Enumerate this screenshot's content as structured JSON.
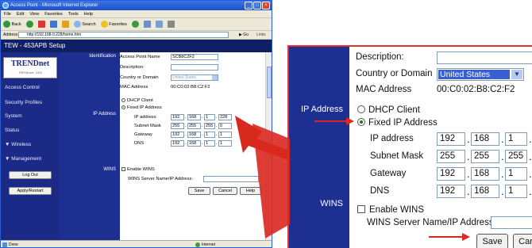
{
  "browser": {
    "title": "Access Point - Microsoft Internet Explorer",
    "menu": [
      "File",
      "Edit",
      "View",
      "Favorites",
      "Tools",
      "Help"
    ],
    "toolbar": {
      "back": "Back",
      "search": "Search",
      "favorites": "Favorites"
    },
    "address_label": "Address",
    "address": "http://192.168.0.228/home.htm",
    "go": "Go",
    "links": "Links",
    "status_left": "Done",
    "status_zone": "Internet"
  },
  "app": {
    "header": "TEW - 453APB Setup",
    "logo_text": "TRENDnet",
    "logo_sub": "TRENDnet, USA",
    "nav": [
      "Access Control",
      "Security Profiles",
      "System",
      "Status",
      "▼ Wireless",
      "▼ Management"
    ],
    "logout": "Log Out",
    "apply": "Apply/Restart"
  },
  "form": {
    "section_identification": "Identification",
    "section_ip": "IP Address",
    "section_wins": "WINS",
    "ap_name_label": "Access Point Name",
    "ap_name_value": "SCB8C2F2",
    "description_label": "Description:",
    "description_value": "",
    "country_label": "Country or Domain",
    "country_value": "United States",
    "mac_label": "MAC Address",
    "mac_value": "00:C0:02:B8:C2:F2",
    "dhcp_label": "DHCP Client",
    "fixed_label": "Fixed IP Address",
    "ip_label": "IP address",
    "ip_label_zoom": "IP address",
    "subnet_label": "Subnet Mask",
    "gateway_label": "Gateway",
    "dns_label": "DNS",
    "ip": [
      "192",
      "168",
      "1",
      "228"
    ],
    "subnet": [
      "255",
      "255",
      "255",
      "0"
    ],
    "gateway": [
      "192",
      "168",
      "1",
      "1"
    ],
    "dns": [
      "192",
      "168",
      "1",
      "1"
    ],
    "enable_wins_label": "Enable WINS",
    "wins_server_label": "WINS Server Name/IP Address:",
    "wins_server_value": "",
    "save": "Save",
    "cancel": "Cancel",
    "cancel_zoom": "Canc",
    "help": "Help"
  },
  "colors": {
    "nav_bg": "#1a2a86",
    "label_col": "#1e2f92",
    "arrow_red": "#d9281e",
    "selected_blue": "#3a5fd0"
  }
}
